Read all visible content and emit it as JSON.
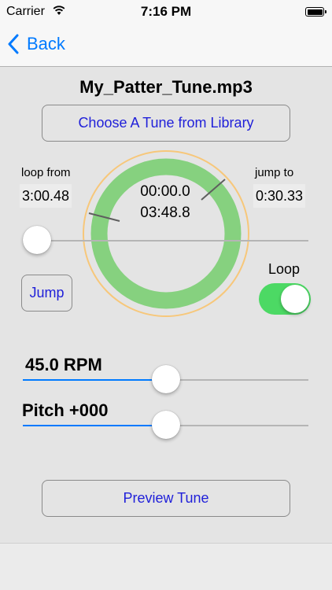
{
  "status_bar": {
    "carrier": "Carrier",
    "time": "7:16 PM"
  },
  "nav": {
    "back_label": "Back"
  },
  "file_name": "My_Patter_Tune.mp3",
  "choose_button": "Choose A Tune from Library",
  "loop_from": {
    "label": "loop from",
    "value": "3:00.48"
  },
  "jump_to": {
    "label": "jump to",
    "value": "0:30.33"
  },
  "dial": {
    "current_time": "00:00.0",
    "total_time": "03:48.8",
    "progress": 0.0
  },
  "position_slider": {
    "value": 0.0
  },
  "jump_button": "Jump",
  "loop_toggle": {
    "label": "Loop",
    "on": true
  },
  "rpm": {
    "label": "45.0 RPM",
    "value": 0.5
  },
  "pitch": {
    "label": "Pitch +000",
    "value": 0.5
  },
  "preview_button": "Preview Tune",
  "colors": {
    "accent": "#007aff",
    "button_text": "#1f1fd9",
    "dial_ring": "#86d17f",
    "dial_outer": "#f7c77a",
    "toggle_on": "#4cd964"
  }
}
